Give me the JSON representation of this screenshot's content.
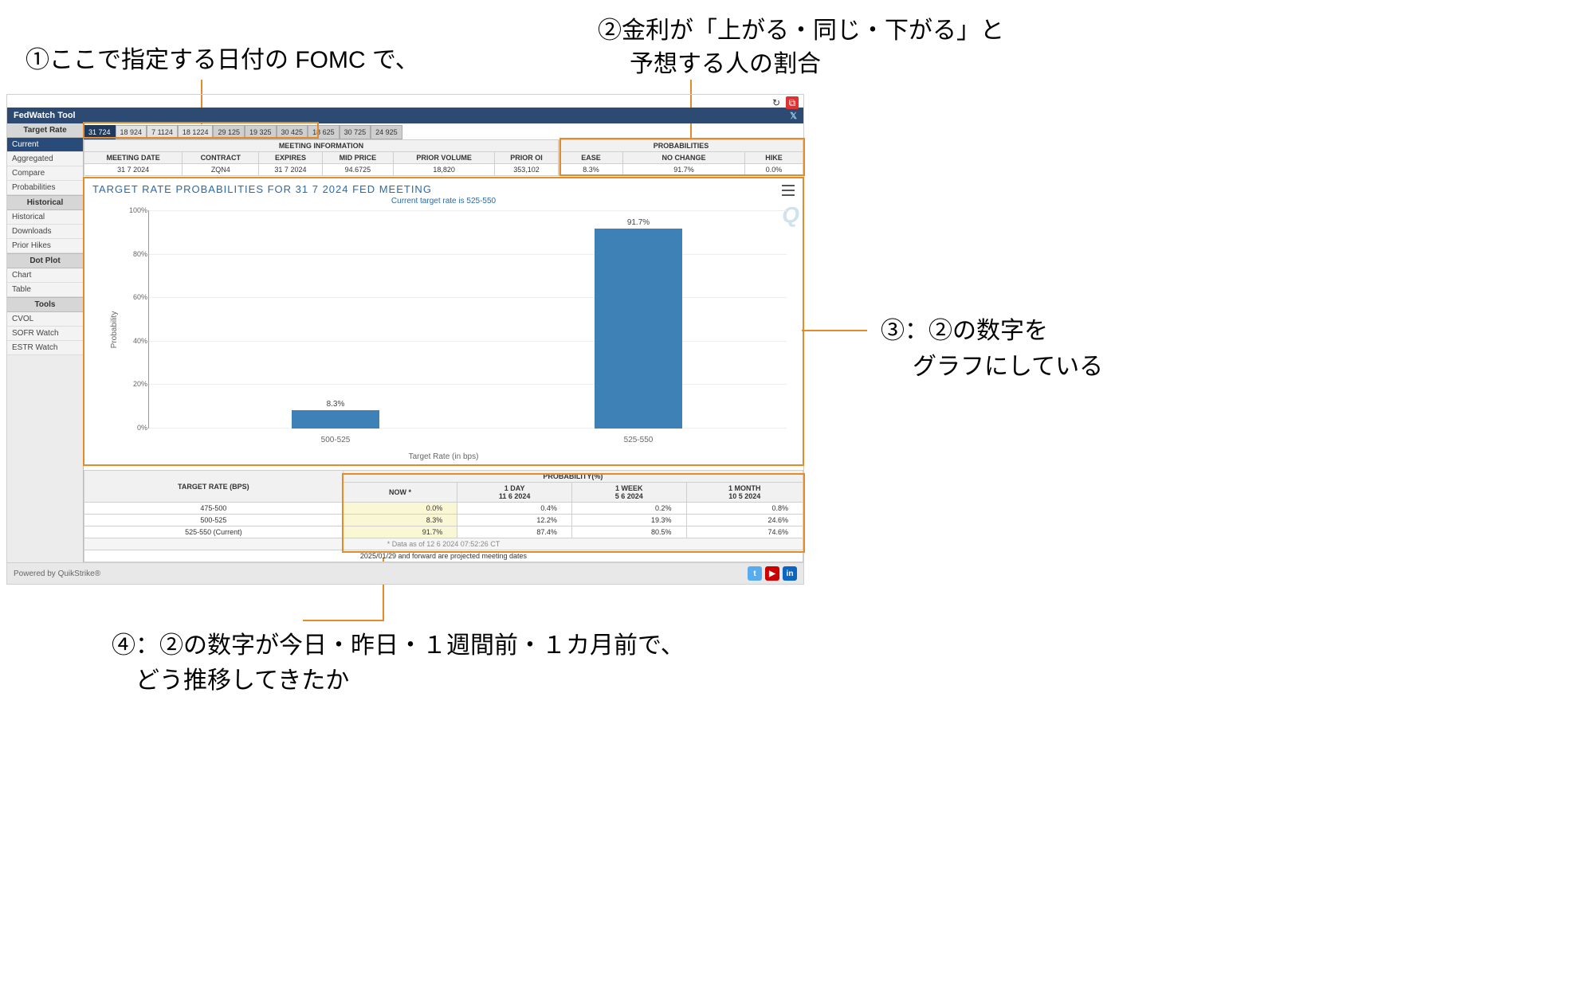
{
  "annotations": {
    "a1": "①ここで指定する日付の FOMC で、",
    "a2_l1": "②金利が「上がる・同じ・下がる」と",
    "a2_l2": "予想する人の割合",
    "a3_l1": "③：②の数字を",
    "a3_l2": "グラフにしている",
    "a4_l1": "④：②の数字が今日・昨日・１週間前・１カ月前で、",
    "a4_l2": "どう推移してきたか"
  },
  "toolbar": {
    "title": "FedWatch Tool",
    "refresh": "↻",
    "popout": "⧉",
    "twitter": "𝕏"
  },
  "sidebar": {
    "target_rate_header": "Target Rate",
    "items_tr": [
      "Current",
      "Aggregated",
      "Compare",
      "Probabilities"
    ],
    "hist_header": "Historical",
    "items_hist": [
      "Historical",
      "Downloads",
      "Prior Hikes"
    ],
    "dot_header": "Dot Plot",
    "items_dot": [
      "Chart",
      "Table"
    ],
    "tools_header": "Tools",
    "items_tools": [
      "CVOL",
      "SOFR Watch",
      "ESTR Watch"
    ]
  },
  "date_tabs": [
    "31 724",
    "18 924",
    "7 1124",
    "18 1224",
    "29 125",
    "19 325",
    "30 425",
    "18 625",
    "30 725",
    "24 925"
  ],
  "meeting_info": {
    "section": "MEETING INFORMATION",
    "headers": [
      "MEETING DATE",
      "CONTRACT",
      "EXPIRES",
      "MID PRICE",
      "PRIOR VOLUME",
      "PRIOR OI"
    ],
    "row": [
      "31 7 2024",
      "ZQN4",
      "31 7 2024",
      "94.6725",
      "18,820",
      "353,102"
    ]
  },
  "probabilities": {
    "section": "PROBABILITIES",
    "headers": [
      "EASE",
      "NO CHANGE",
      "HIKE"
    ],
    "row": [
      "8.3%",
      "91.7%",
      "0.0%"
    ]
  },
  "chart": {
    "title": "TARGET RATE PROBABILITIES FOR 31 7 2024 FED MEETING",
    "subtitle": "Current target rate is 525-550",
    "ylabel": "Probability",
    "xlabel": "Target Rate (in bps)",
    "watermark": "Q"
  },
  "chart_data": {
    "type": "bar",
    "categories": [
      "500-525",
      "525-550"
    ],
    "values": [
      8.3,
      91.7
    ],
    "value_labels": [
      "8.3%",
      "91.7%"
    ],
    "title": "TARGET RATE PROBABILITIES FOR 31 7 2024 FED MEETING",
    "xlabel": "Target Rate (in bps)",
    "ylabel": "Probability",
    "ylim": [
      0,
      100
    ],
    "yticks": [
      0,
      20,
      40,
      60,
      80,
      100
    ],
    "ytick_labels": [
      "0%",
      "20%",
      "40%",
      "60%",
      "80%",
      "100%"
    ]
  },
  "history": {
    "left_header": "TARGET RATE (BPS)",
    "prob_header": "PROBABILITY(%)",
    "col_now": "NOW *",
    "cols": [
      {
        "h1": "1 DAY",
        "h2": "11 6 2024"
      },
      {
        "h1": "1 WEEK",
        "h2": "5 6 2024"
      },
      {
        "h1": "1 MONTH",
        "h2": "10 5 2024"
      }
    ],
    "rows": [
      {
        "rate": "475-500",
        "now": "0.0%",
        "d1": "0.4%",
        "w1": "0.2%",
        "m1": "0.8%"
      },
      {
        "rate": "500-525",
        "now": "8.3%",
        "d1": "12.2%",
        "w1": "19.3%",
        "m1": "24.6%"
      },
      {
        "rate": "525-550 (Current)",
        "now": "91.7%",
        "d1": "87.4%",
        "w1": "80.5%",
        "m1": "74.6%"
      }
    ],
    "footnote": "* Data as of 12 6 2024 07:52:26 CT",
    "projnote": "2025/01/29 and forward are projected meeting dates"
  },
  "footer": {
    "powered": "Powered by QuikStrike®"
  }
}
